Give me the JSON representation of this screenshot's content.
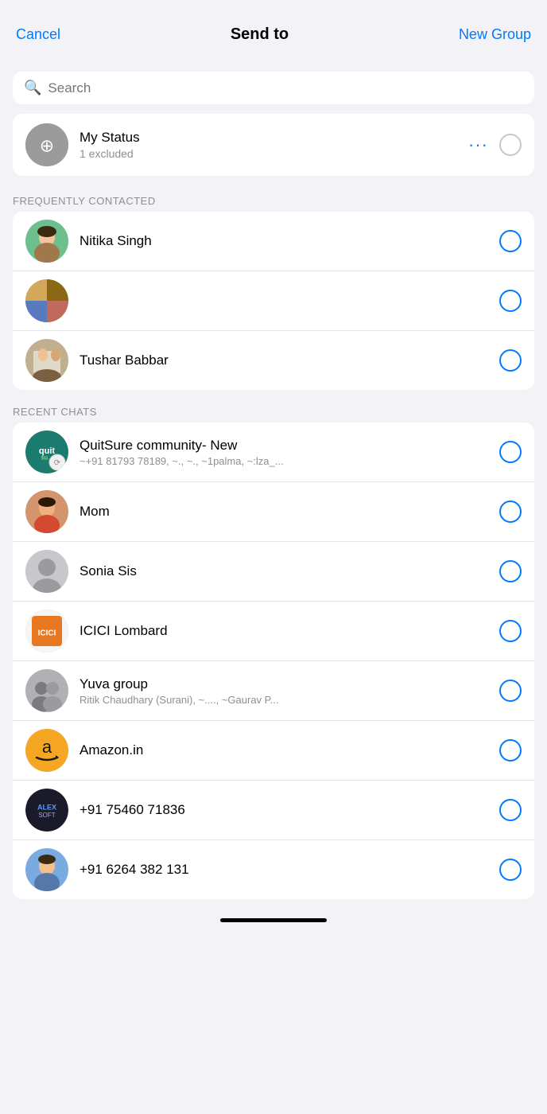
{
  "header": {
    "cancel_label": "Cancel",
    "title": "Send to",
    "new_group_label": "New Group"
  },
  "search": {
    "placeholder": "Search"
  },
  "my_status": {
    "name": "My Status",
    "sub": "1 excluded"
  },
  "frequently_contacted": {
    "section_label": "FREQUENTLY CONTACTED",
    "contacts": [
      {
        "id": "nitika",
        "name": "Nitika Singh",
        "sub": "",
        "avatar_type": "photo_green"
      },
      {
        "id": "unknown1",
        "name": "",
        "sub": "",
        "avatar_type": "photo_collage"
      },
      {
        "id": "tushar",
        "name": "Tushar Babbar",
        "sub": "",
        "avatar_type": "photo_couple"
      }
    ]
  },
  "recent_chats": {
    "section_label": "RECENT CHATS",
    "contacts": [
      {
        "id": "quitsure",
        "name": "QuitSure community- New",
        "sub": "~+91 81793 78189, ~., ~., ~1palma, ~:lza_...",
        "avatar_type": "quitsure"
      },
      {
        "id": "mom",
        "name": "Mom",
        "sub": "",
        "avatar_type": "photo_mom"
      },
      {
        "id": "sonia",
        "name": "Sonia Sis",
        "sub": "",
        "avatar_type": "person_gray"
      },
      {
        "id": "icici",
        "name": "ICICI Lombard",
        "sub": "",
        "avatar_type": "photo_icici"
      },
      {
        "id": "yuva",
        "name": "Yuva group",
        "sub": "Ritik Chaudhary (Surani), ~...., ~Gaurav P...",
        "avatar_type": "group_gray"
      },
      {
        "id": "amazon",
        "name": "Amazon.in",
        "sub": "",
        "avatar_type": "amazon"
      },
      {
        "id": "phone1",
        "name": "+91 75460 71836",
        "sub": "",
        "avatar_type": "photo_dark"
      },
      {
        "id": "phone2",
        "name": "+91 6264 382 131",
        "sub": "",
        "avatar_type": "photo_guy"
      }
    ]
  }
}
